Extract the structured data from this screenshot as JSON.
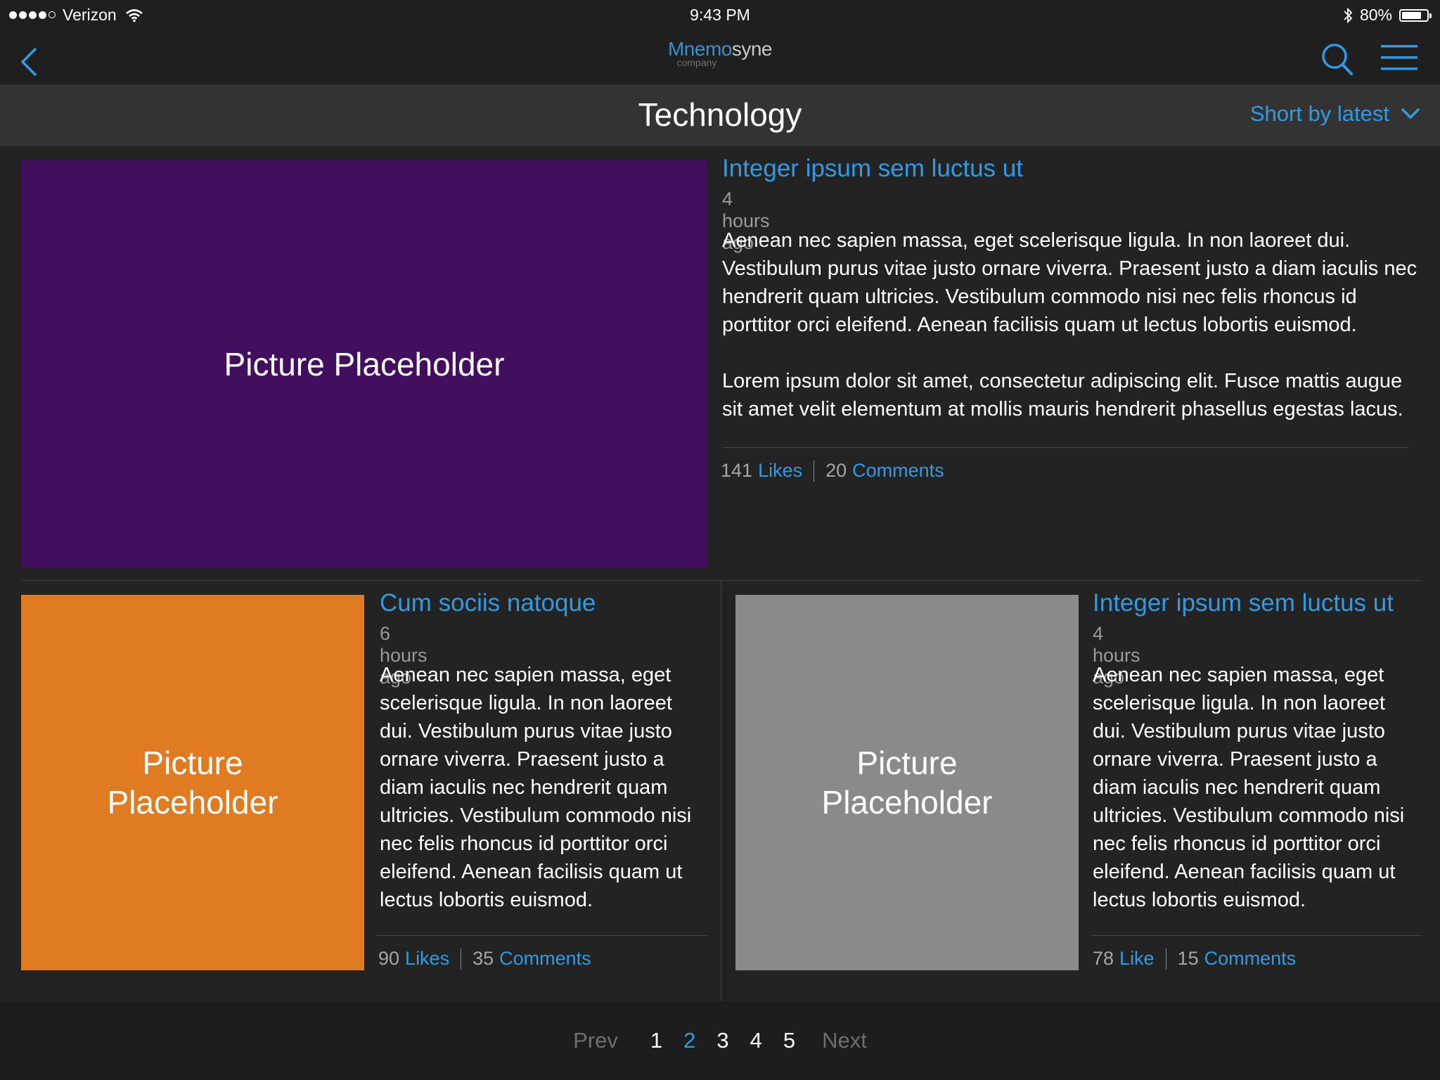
{
  "status_bar": {
    "carrier": "Verizon",
    "time": "9:43 PM",
    "battery_percent_label": "80%",
    "battery_level": 0.8
  },
  "nav": {
    "logo_part1": "Mnemo",
    "logo_part2": "syne",
    "logo_subtitle": "company"
  },
  "category": {
    "title": "Technology",
    "sort_label": "Short by latest"
  },
  "posts": [
    {
      "placeholder": "Picture Placeholder",
      "placeholder_color": "#420e5e",
      "title": "Integer ipsum sem luctus ut",
      "time": "4 hours ago",
      "body_p1": "Aenean nec sapien massa, eget scelerisque ligula. In non laoreet dui. Vestibulum purus vitae justo ornare viverra. Praesent justo a diam iaculis nec hendrerit quam ultricies. Vestibulum commodo nisi nec felis rhoncus id porttitor orci eleifend. Aenean facilisis quam ut lectus lobortis euismod.",
      "body_p2": "Lorem ipsum dolor sit amet, consectetur adipiscing elit. Fusce mattis augue sit amet velit elementum at mollis mauris hendrerit phasellus egestas lacus.",
      "likes_count": "141",
      "likes_label": "Likes",
      "comments_count": "20",
      "comments_label": "Comments"
    },
    {
      "placeholder_line1": "Picture",
      "placeholder_line2": "Placeholder",
      "placeholder_color": "#e07b22",
      "title": "Cum sociis natoque",
      "time": "6 hours ago",
      "body": "Aenean nec sapien massa, eget scelerisque ligula. In non laoreet dui. Vestibulum purus vitae justo ornare viverra. Praesent justo a diam iaculis nec hendrerit quam ultricies. Vestibulum commodo nisi nec felis rhoncus id porttitor orci eleifend. Aenean facilisis quam ut lectus lobortis euismod.",
      "likes_count": "90",
      "likes_label": "Likes",
      "comments_count": "35",
      "comments_label": "Comments"
    },
    {
      "placeholder_line1": "Picture",
      "placeholder_line2": "Placeholder",
      "placeholder_color": "#8a8a8a",
      "title": "Integer ipsum sem luctus ut",
      "time": "4 hours ago",
      "body": "Aenean nec sapien massa, eget scelerisque ligula. In non laoreet dui. Vestibulum purus vitae justo ornare viverra. Praesent justo a diam iaculis nec hendrerit quam ultricies. Vestibulum commodo nisi nec felis rhoncus id porttitor orci eleifend. Aenean facilisis quam ut lectus lobortis euismod.",
      "likes_count": "78",
      "likes_label": "Like",
      "comments_count": "15",
      "comments_label": "Comments"
    }
  ],
  "pagination": {
    "prev": "Prev",
    "pages": [
      "1",
      "2",
      "3",
      "4",
      "5"
    ],
    "current": "2",
    "next": "Next"
  },
  "colors": {
    "accent": "#2f9be6",
    "background": "#232323",
    "header": "#1f1f1f",
    "category_bar": "#333333"
  },
  "icons": [
    "signal-icon",
    "wifi-icon",
    "bluetooth-icon",
    "battery-icon",
    "back-chevron-icon",
    "search-icon",
    "menu-icon",
    "chevron-down-icon"
  ]
}
